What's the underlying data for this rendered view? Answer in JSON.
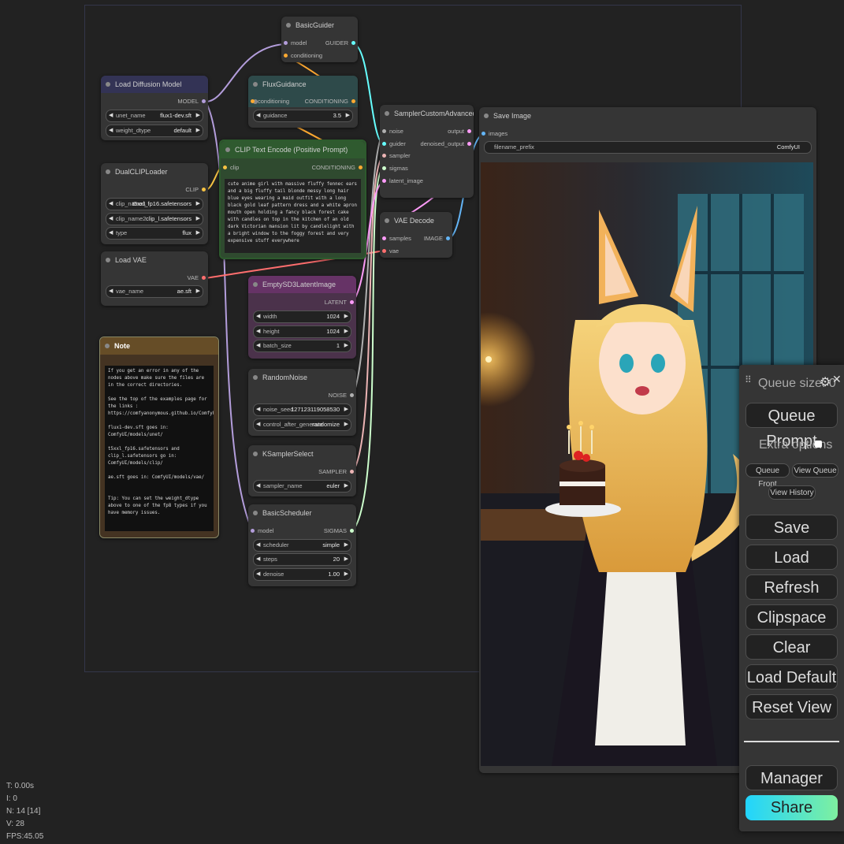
{
  "nodes": {
    "basic_guider": {
      "title": "BasicGuider",
      "in": [
        "model",
        "conditioning"
      ],
      "out": "GUIDER"
    },
    "load_diffusion_model": {
      "title": "Load Diffusion Model",
      "out": "MODEL",
      "widgets": [
        {
          "label": "unet_name",
          "value": "flux1-dev.sft"
        },
        {
          "label": "weight_dtype",
          "value": "default"
        }
      ]
    },
    "flux_guidance": {
      "title": "FluxGuidance",
      "in": "conditioning",
      "out": "CONDITIONING",
      "widgets": [
        {
          "label": "guidance",
          "value": "3.5"
        }
      ]
    },
    "clip_text_encode": {
      "title": "CLIP Text Encode (Positive Prompt)",
      "in": "clip",
      "out": "CONDITIONING",
      "prompt": "cute anime girl with massive fluffy fennec ears and a big fluffy tail blonde messy long hair blue eyes wearing a maid outfit with a long black gold leaf pattern dress and a white apron mouth open holding a fancy black forest cake with candles on top in the kitchen of an old dark Victorian mansion lit by candlelight with a bright window to the foggy forest and very expensive stuff everywhere"
    },
    "dual_clip_loader": {
      "title": "DualCLIPLoader",
      "out": "CLIP",
      "widgets": [
        {
          "label": "clip_name1",
          "value": "t5xxl_fp16.safetensors"
        },
        {
          "label": "clip_name2",
          "value": "clip_l.safetensors"
        },
        {
          "label": "type",
          "value": "flux"
        }
      ]
    },
    "load_vae": {
      "title": "Load VAE",
      "out": "VAE",
      "widgets": [
        {
          "label": "vae_name",
          "value": "ae.sft"
        }
      ]
    },
    "sampler_custom_advanced": {
      "title": "SamplerCustomAdvanced",
      "in": [
        "noise",
        "guider",
        "sampler",
        "sigmas",
        "latent_image"
      ],
      "out": [
        "output",
        "denoised_output"
      ]
    },
    "vae_decode": {
      "title": "VAE Decode",
      "in": [
        "samples",
        "vae"
      ],
      "out": "IMAGE"
    },
    "empty_latent": {
      "title": "EmptySD3LatentImage",
      "out": "LATENT",
      "widgets": [
        {
          "label": "width",
          "value": "1024"
        },
        {
          "label": "height",
          "value": "1024"
        },
        {
          "label": "batch_size",
          "value": "1"
        }
      ]
    },
    "random_noise": {
      "title": "RandomNoise",
      "out": "NOISE",
      "widgets": [
        {
          "label": "noise_seed",
          "value": "127123119058530"
        },
        {
          "label": "control_after_generate",
          "value": "randomize"
        }
      ]
    },
    "ksampler_select": {
      "title": "KSamplerSelect",
      "out": "SAMPLER",
      "widgets": [
        {
          "label": "sampler_name",
          "value": "euler"
        }
      ]
    },
    "basic_scheduler": {
      "title": "BasicScheduler",
      "in": "model",
      "out": "SIGMAS",
      "widgets": [
        {
          "label": "scheduler",
          "value": "simple"
        },
        {
          "label": "steps",
          "value": "20"
        },
        {
          "label": "denoise",
          "value": "1.00"
        }
      ]
    },
    "note": {
      "title": "Note",
      "text": "If you get an error in any of the nodes above make sure the files are in the correct directories.\n\nSee the top of the examples page for the links :\nhttps://comfyanonymous.github.io/ComfyUI_examples/flux/\n\nflux1-dev.sft goes in: ComfyUI/models/unet/\n\nt5xxl_fp16.safetensors and clip_l.safetensors go in: ComfyUI/models/clip/\n\nae.sft goes in: ComfyUI/models/vae/\n\n\nTip: You can set the weight_dtype above to one of the fp8 types if you have memory issues."
    },
    "save_image": {
      "title": "Save Image",
      "in": "images",
      "widgets": [
        {
          "label": "filename_prefix",
          "value": "ComfyUI"
        }
      ]
    }
  },
  "queue_panel": {
    "queue_size": "Queue size: 0",
    "queue_prompt": "Queue Prompt",
    "extra_options": "Extra options",
    "queue_front": "Queue Front",
    "view_queue": "View Queue",
    "view_history": "View History",
    "save": "Save",
    "load": "Load",
    "refresh": "Refresh",
    "clipspace": "Clipspace",
    "clear": "Clear",
    "load_default": "Load Default",
    "reset_view": "Reset View",
    "manager": "Manager",
    "share": "Share"
  },
  "stats": {
    "t": "T: 0.00s",
    "i": "I: 0",
    "n": "N: 14 [14]",
    "v": "V: 28",
    "fps": "FPS:45.05"
  },
  "colors": {
    "model": "#b39ddb",
    "clip": "#f6c343",
    "vae": "#ff6e6e",
    "conditioning": "#ffa931",
    "latent": "#ff9cf9",
    "image": "#64b5f6",
    "guider": "#66ffff",
    "noise": "#b0b0b0",
    "sampler": "#ecb4b4",
    "sigmas": "#cdffcd"
  }
}
